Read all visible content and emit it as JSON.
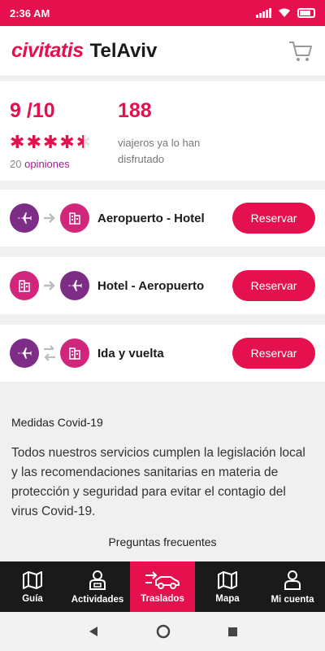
{
  "status": {
    "time": "2:36 AM"
  },
  "header": {
    "brand": "civitatis",
    "city": "TelAviv"
  },
  "rating": {
    "score": "9 /10",
    "stars": 4.5,
    "opinions_count": "20",
    "opinions_label": "opiniones",
    "travelers_count": "188",
    "travelers_text": "viajeros ya lo han disfrutado"
  },
  "routes": [
    {
      "title": "Aeropuerto - Hotel",
      "button": "Reservar",
      "from_icon": "airplane-icon",
      "to_icon": "hotel-icon"
    },
    {
      "title": "Hotel - Aeropuerto",
      "button": "Reservar",
      "from_icon": "hotel-icon",
      "to_icon": "airplane-icon"
    },
    {
      "title": "Ida y vuelta",
      "button": "Reservar",
      "from_icon": "airplane-icon",
      "to_icon": "hotel-icon"
    }
  ],
  "covid": {
    "title": "Medidas Covid-19",
    "text": "Todos nuestros servicios cumplen la legislación local y las recomendaciones sanitarias en materia de protección y seguridad para evitar el contagio del virus Covid-19."
  },
  "faq": "Preguntas frecuentes",
  "nav": [
    {
      "label": "Guía",
      "icon": "map-guide-icon"
    },
    {
      "label": "Actividades",
      "icon": "person-ticket-icon"
    },
    {
      "label": "Traslados",
      "icon": "car-transfer-icon",
      "active": true
    },
    {
      "label": "Mapa",
      "icon": "map-icon"
    },
    {
      "label": "Mi cuenta",
      "icon": "user-icon"
    }
  ],
  "colors": {
    "brand": "#e5114f",
    "purple": "#7e2d86",
    "pink": "#d2257c",
    "nav_bg": "#1a1a1a"
  }
}
